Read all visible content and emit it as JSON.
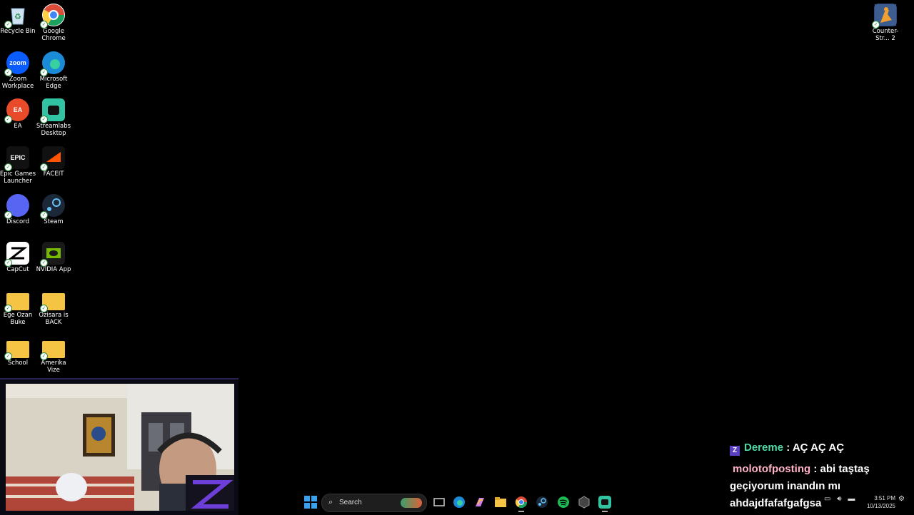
{
  "desktop": {
    "icons": [
      {
        "label": "Recycle Bin",
        "icon": "recycle-bin-icon"
      },
      {
        "label": "Google Chrome",
        "icon": "chrome-icon"
      },
      {
        "label": "Zoom Workplace",
        "icon": "zoom-icon",
        "text": "zoom"
      },
      {
        "label": "Microsoft Edge",
        "icon": "edge-icon"
      },
      {
        "label": "EA",
        "icon": "ea-icon",
        "text": "EA"
      },
      {
        "label": "Streamlabs Desktop",
        "icon": "streamlabs-icon"
      },
      {
        "label": "Epic Games Launcher",
        "icon": "epic-games-icon",
        "text": "EPIC"
      },
      {
        "label": "FACEIT",
        "icon": "faceit-icon"
      },
      {
        "label": "Discord",
        "icon": "discord-icon"
      },
      {
        "label": "Steam",
        "icon": "steam-icon"
      },
      {
        "label": "CapCut",
        "icon": "capcut-icon"
      },
      {
        "label": "NVIDIA App",
        "icon": "nvidia-icon"
      },
      {
        "label": "Ege Ozan Buke",
        "icon": "folder-icon"
      },
      {
        "label": "Ozisara is BACK",
        "icon": "folder-icon"
      },
      {
        "label": "School",
        "icon": "folder-icon"
      },
      {
        "label": "Amerika Vize",
        "icon": "folder-icon"
      }
    ],
    "right_icon": {
      "label": "Counter-Str... 2",
      "icon": "counter-strike-icon"
    }
  },
  "chat": {
    "messages": [
      {
        "user": "Dereme",
        "text": ": AÇ AÇ AÇ",
        "color": "#4fd8a6"
      },
      {
        "user": "molotofposting",
        "text": ": abi taştaş",
        "color": "#ffb3c7"
      },
      {
        "user": "",
        "text": "geçiyorum inandın mı",
        "color": "#ffffff"
      },
      {
        "user": "",
        "text": "ahdajdfafafgafgsa",
        "color": "#ffffff"
      }
    ]
  },
  "taskbar": {
    "search_placeholder": "Search",
    "clock_time": "3:51 PM",
    "clock_date": "10/13/2025"
  }
}
